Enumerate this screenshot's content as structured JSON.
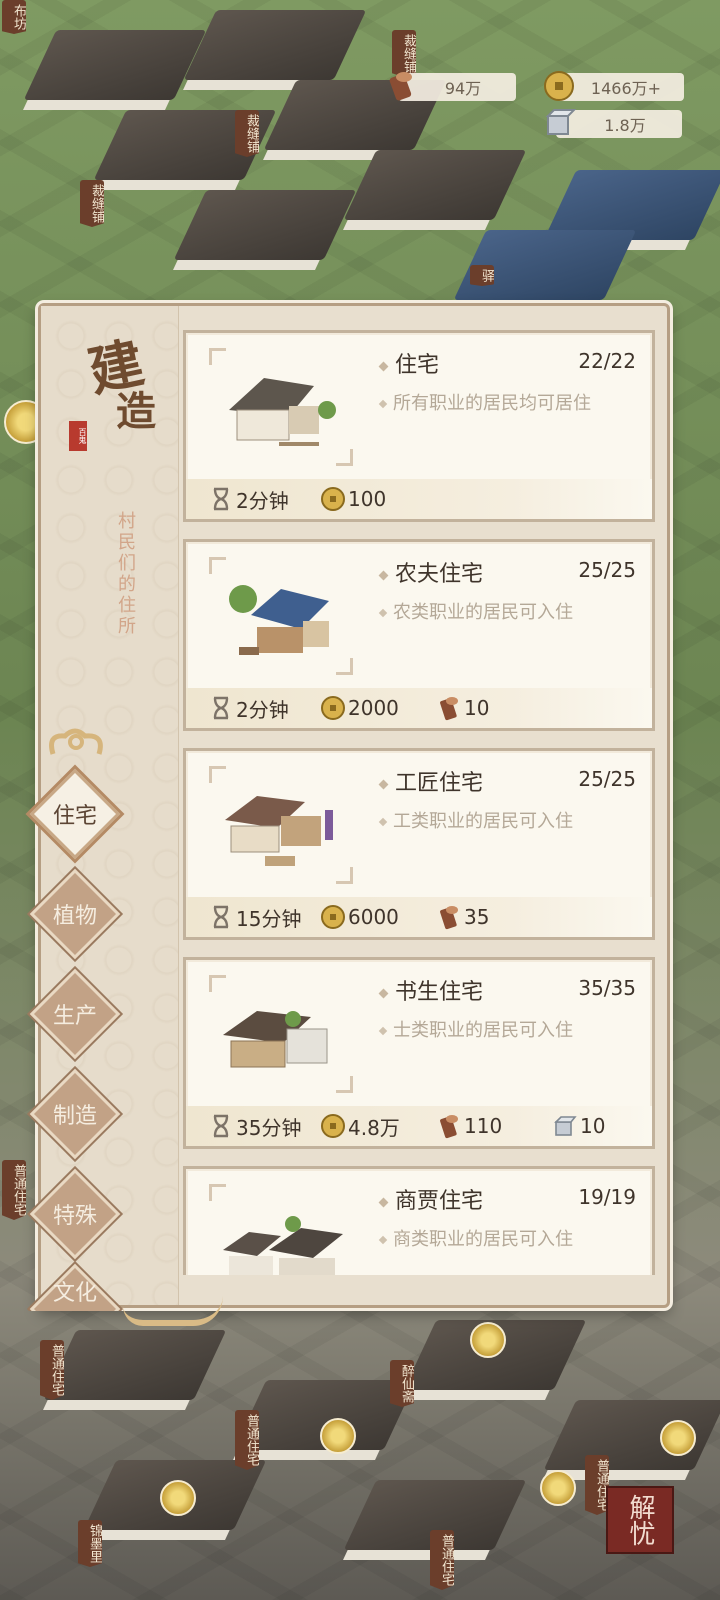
{
  "resources": {
    "wood": "94万",
    "coins": "1466万+",
    "stone": "1.8万"
  },
  "panel": {
    "title_glyph_1": "建",
    "title_glyph_2": "造",
    "seal": "百鬼",
    "subtitle": "村民们的住所",
    "tabs": [
      {
        "label": "住宅",
        "active": true
      },
      {
        "label": "植物",
        "active": false
      },
      {
        "label": "生产",
        "active": false
      },
      {
        "label": "制造",
        "active": false
      },
      {
        "label": "特殊",
        "active": false
      },
      {
        "label": "文化",
        "active": false
      }
    ],
    "buildings": [
      {
        "name": "住宅",
        "count": "22/22",
        "desc": "所有职业的居民均可居住",
        "time": "2分钟",
        "coins": "100",
        "wood": null,
        "stone": null
      },
      {
        "name": "农夫住宅",
        "count": "25/25",
        "desc": "农类职业的居民可入住",
        "time": "2分钟",
        "coins": "2000",
        "wood": "10",
        "stone": null
      },
      {
        "name": "工匠住宅",
        "count": "25/25",
        "desc": "工类职业的居民可入住",
        "time": "15分钟",
        "coins": "6000",
        "wood": "35",
        "stone": null
      },
      {
        "name": "书生住宅",
        "count": "35/35",
        "desc": "士类职业的居民可入住",
        "time": "35分钟",
        "coins": "4.8万",
        "wood": "110",
        "stone": "10"
      },
      {
        "name": "商贾住宅",
        "count": "19/19",
        "desc": "商类职业的居民可入住",
        "time": null,
        "coins": null,
        "wood": null,
        "stone": null
      }
    ]
  },
  "town_signs": [
    "布坊",
    "裁缝铺",
    "裁缝铺",
    "裁缝铺",
    "驿",
    "普通住宅",
    "普通住宅",
    "普通住宅",
    "普通住宅",
    "醉仙斋",
    "锦墨里",
    "普通住宅"
  ],
  "corner_seal": "解忧",
  "colors": {
    "panel_bg": "#e8dfcf",
    "card_bg": "#fbf8ef",
    "tab_active": "#f6f0e4",
    "tab_inactive": "#c2a286",
    "accent_brown": "#6f4b2f"
  }
}
